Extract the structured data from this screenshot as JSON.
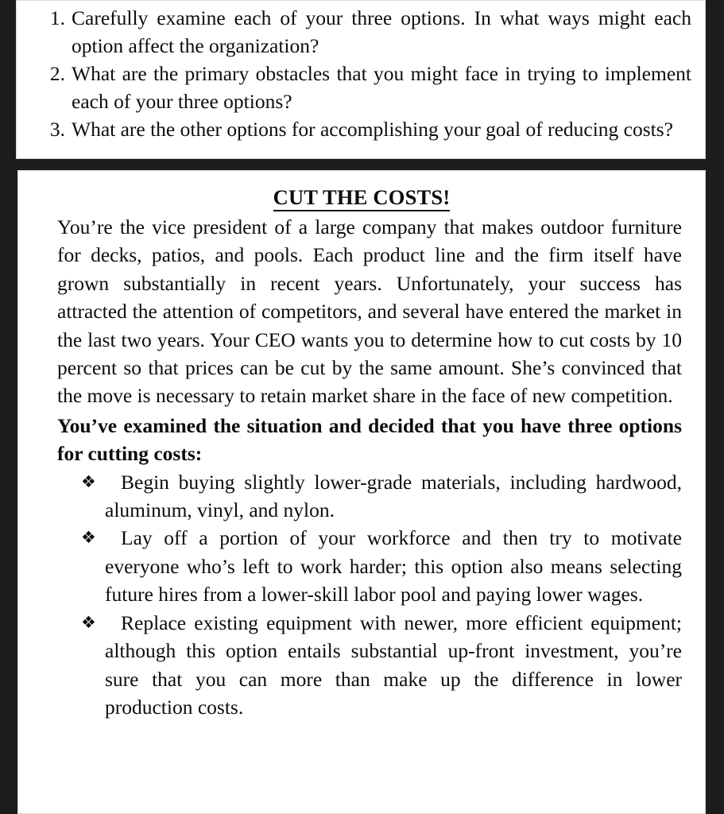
{
  "document": {
    "type": "scanned-textbook-page",
    "background_color": "#1c1c1c",
    "page_color": "#ffffff"
  },
  "top_panel": {
    "name": "discussion-questions",
    "items": [
      {
        "number": "1.",
        "text": "Carefully examine each of your three options. In what ways might each option affect the organization?"
      },
      {
        "number": "2.",
        "text": "What are the primary obstacles that you might face in trying to implement each of your three options?"
      },
      {
        "number": "3.",
        "text": "What are the other options for accomplishing your goal of reducing costs?"
      }
    ]
  },
  "case_study": {
    "title": "CUT THE COSTS!",
    "paragraph": "You’re the vice president of a large company that makes outdoor furniture for decks, patios, and pools. Each product line and the firm itself have grown substantially in recent years. Unfortunately, your success has attracted the attention of competitors, and several have entered the market in the last two years. Your CEO wants you to determine how to cut costs by 10 percent so that prices can be cut by the same amount. She’s convinced that the move is necessary to retain market share in the face of new competition.",
    "lead_in": "You’ve examined the situation and decided that you have three options for cutting costs:",
    "bullet_glyph": "❖",
    "options": [
      {
        "text": "Begin buying slightly lower-grade materials, including hardwood, aluminum, vinyl, and nylon."
      },
      {
        "text": "Lay off a portion of your workforce and then try to motivate everyone who’s left to work harder; this option also means selecting future hires from a lower-skill labor pool and paying lower wages."
      },
      {
        "text": "Replace existing equipment with newer, more efficient equipment; although this option entails substantial up-front investment, you’re sure that you can more than make up the difference in lower production costs."
      }
    ]
  }
}
